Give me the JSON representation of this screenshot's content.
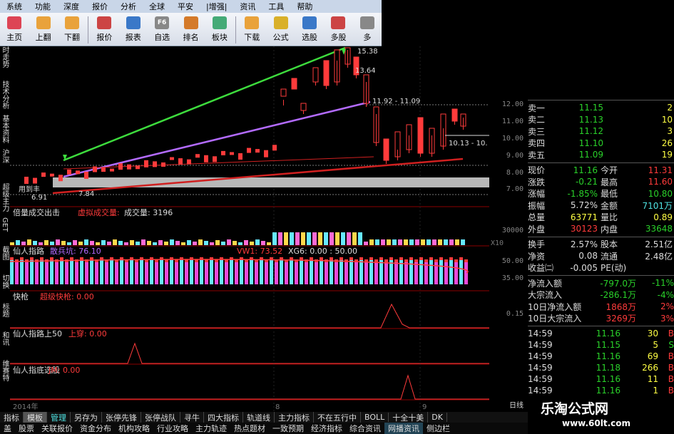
{
  "menu": [
    "系统",
    "功能",
    "深度",
    "报价",
    "分析",
    "全球",
    "平安",
    "|增强|",
    "资讯",
    "工具",
    "帮助"
  ],
  "toolbar": [
    {
      "label": "主页",
      "icon": "home-icon",
      "color": "#d45"
    },
    {
      "label": "上翻",
      "icon": "arrow-up-icon",
      "color": "#e9a23b"
    },
    {
      "label": "下翻",
      "icon": "arrow-down-icon",
      "color": "#e9a23b"
    },
    {
      "label": "报价",
      "icon": "quote-icon",
      "color": "#c44"
    },
    {
      "label": "报表",
      "icon": "report-icon",
      "color": "#3a78c8"
    },
    {
      "label": "自选",
      "icon": "f6-icon",
      "color": "#888",
      "text": "F6"
    },
    {
      "label": "排名",
      "icon": "rank-icon",
      "color": "#d47a2a"
    },
    {
      "label": "板块",
      "icon": "sector-icon",
      "color": "#4a7"
    },
    {
      "label": "下载",
      "icon": "download-icon",
      "color": "#e9a23b"
    },
    {
      "label": "公式",
      "icon": "formula-icon",
      "color": "#d9b02a"
    },
    {
      "label": "选股",
      "icon": "pick-icon",
      "color": "#3a78c8"
    },
    {
      "label": "多股",
      "icon": "multi-icon",
      "color": "#c44"
    },
    {
      "label": "多",
      "icon": "more-icon",
      "color": "#888"
    }
  ],
  "leftbar": [
    "时走势",
    "技术分析",
    "基本资料",
    "沪深",
    "超级主力",
    "GET",
    "截图",
    "切换",
    "标题",
    "和讯",
    "维赛特"
  ],
  "chart_labels": {
    "p1538": "15.38",
    "p1364": "13.64",
    "p1092": "11.92 - 11.09",
    "p1013": "10.13 - 10.",
    "p784": "7.84",
    "p691": "6.91",
    "yongdao": "用到丰",
    "volume_title": "倍量成交出击",
    "volume_virtual": "虚拟成交量:",
    "volume_label": "成交量: 3196",
    "ind1": "仙人指路",
    "ind1b": "散兵坑: 76.10",
    "ind1c": "VW1: 73.52",
    "ind1d": "XG6: 0.00 : 50.00",
    "ind2": "快枪",
    "ind2b": "超级快枪: 0.00",
    "ind3": "仙人指路上50",
    "ind3b": "上穿: 0.00",
    "ind4": "仙人指底选股",
    "ind4b": "JM: 0.00",
    "year": "2014年",
    "m8": "8",
    "m9": "9",
    "day": "日线",
    "x10": "X10"
  },
  "axis": [
    {
      "v": "12.00",
      "t": "147"
    },
    {
      "v": "11.00",
      "t": "171"
    },
    {
      "v": "10.00",
      "t": "195"
    },
    {
      "v": "9.00",
      "t": "219"
    },
    {
      "v": "8.00",
      "t": "243"
    },
    {
      "v": "7.00",
      "t": "266"
    },
    {
      "v": "30000",
      "t": "324"
    },
    {
      "v": "50.00",
      "t": "367"
    },
    {
      "v": "35.00",
      "t": "391"
    },
    {
      "v": "0.15",
      "t": "441"
    }
  ],
  "orderbook": [
    {
      "k": "卖一",
      "p": "11.15",
      "v": "2",
      "pc": "g"
    },
    {
      "k": "卖二",
      "p": "11.13",
      "v": "10",
      "pc": "g"
    },
    {
      "k": "卖三",
      "p": "11.12",
      "v": "3",
      "pc": "g"
    },
    {
      "k": "卖四",
      "p": "11.10",
      "v": "26",
      "pc": "g"
    },
    {
      "k": "卖五",
      "p": "11.09",
      "v": "19",
      "pc": "g"
    }
  ],
  "stats": [
    {
      "a": "现价",
      "b": "11.16",
      "bc": "g",
      "c": "今开",
      "d": "11.31",
      "dc": "r"
    },
    {
      "a": "涨跌",
      "b": "-0.21",
      "bc": "g",
      "c": "最高",
      "d": "11.60",
      "dc": "r"
    },
    {
      "a": "涨幅",
      "b": "-1.85%",
      "bc": "g",
      "c": "最低",
      "d": "10.80",
      "dc": "g"
    },
    {
      "a": "振幅",
      "b": "5.72%",
      "bc": "w",
      "c": "金额",
      "d": "7101万",
      "dc": "c"
    },
    {
      "a": "总量",
      "b": "63771",
      "bc": "y",
      "c": "量比",
      "d": "0.89",
      "dc": "y"
    },
    {
      "a": "外盘",
      "b": "30123",
      "bc": "r",
      "c": "内盘",
      "d": "33648",
      "dc": "g"
    }
  ],
  "stats2": [
    {
      "a": "换手",
      "b": "2.57%",
      "bc": "w",
      "c": "股本",
      "d": "2.51亿",
      "dc": "w"
    },
    {
      "a": "净资",
      "b": "0.08",
      "bc": "w",
      "c": "流通",
      "d": "2.48亿",
      "dc": "w"
    },
    {
      "a": "收益㈡",
      "b": "-0.005",
      "bc": "w",
      "c": "PE(动)",
      "d": "",
      "dc": "w"
    }
  ],
  "flows": [
    {
      "a": "净流入额",
      "b": "-797.0万",
      "bc": "g",
      "d": "-11%",
      "dc": "g"
    },
    {
      "a": "大宗流入",
      "b": "-286.1万",
      "bc": "g",
      "d": "-4%",
      "dc": "g"
    },
    {
      "a": "10日净流入额",
      "b": "1868万",
      "bc": "r",
      "d": "2%",
      "dc": "r"
    },
    {
      "a": "10日大宗流入",
      "b": "3269万",
      "bc": "r",
      "d": "3%",
      "dc": "r"
    }
  ],
  "ticks": [
    {
      "t": "14:59",
      "p": "11.16",
      "v": "30",
      "s": "B",
      "sc": "r"
    },
    {
      "t": "14:59",
      "p": "11.15",
      "v": "5",
      "s": "S",
      "sc": "g"
    },
    {
      "t": "14:59",
      "p": "11.16",
      "v": "69",
      "s": "B",
      "sc": "r"
    },
    {
      "t": "14:59",
      "p": "11.18",
      "v": "266",
      "s": "B",
      "sc": "r"
    },
    {
      "t": "14:59",
      "p": "11.16",
      "v": "11",
      "s": "B",
      "sc": "r"
    },
    {
      "t": "14:59",
      "p": "11.16",
      "v": "1",
      "s": "B",
      "sc": "r"
    }
  ],
  "bottomtabs": [
    "指标",
    "模板",
    "管理",
    "另存为",
    "张停先锋",
    "张停战队",
    "寻牛",
    "四大指标",
    "轨道线",
    "主力指标",
    "不在五行中",
    "BOLL",
    "十全十美",
    "DK"
  ],
  "bottombar": [
    "盖",
    "股票",
    "关联报价",
    "资金分布",
    "机构攻略",
    "行业攻略",
    "主力轨迹",
    "热点题材",
    "一致预期",
    "经济指标",
    "综合资讯",
    "网播资讯",
    "侧边栏"
  ],
  "watermark": {
    "title": "乐淘公式网",
    "url": "www.60lt.com"
  }
}
